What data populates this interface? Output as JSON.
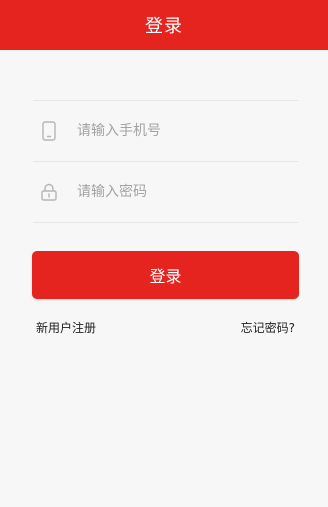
{
  "header": {
    "title": "登录"
  },
  "form": {
    "phone": {
      "placeholder": "请输入手机号",
      "value": "",
      "icon": "phone-icon"
    },
    "password": {
      "placeholder": "请输入密码",
      "value": "",
      "icon": "lock-icon"
    }
  },
  "actions": {
    "login_label": "登录",
    "register_label": "新用户注册",
    "forgot_label": "忘记密码?"
  },
  "colors": {
    "primary": "#e52420",
    "background": "#f7f7f7",
    "divider": "#e6e6e6",
    "placeholder": "#a3a3a3",
    "icon": "#b5b5b5"
  }
}
